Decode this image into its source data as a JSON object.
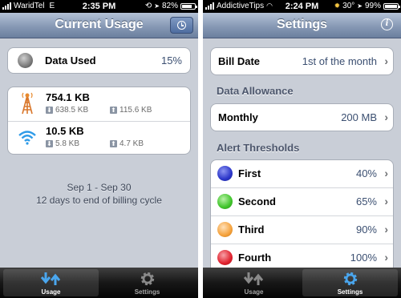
{
  "left_screen": {
    "status": {
      "carrier": "WaridTel",
      "network": "E",
      "time": "2:35 PM",
      "battery": "82%"
    },
    "title": "Current Usage",
    "data_used": {
      "label": "Data Used",
      "value": "15%",
      "indicator_color": "#7a7a7a"
    },
    "cellular": {
      "icon": "cell-tower-icon",
      "total": "754.1 KB",
      "download": "638.5 KB",
      "upload": "115.6 KB"
    },
    "wifi": {
      "icon": "wifi-icon",
      "total": "10.5 KB",
      "download": "5.8 KB",
      "upload": "4.7 KB"
    },
    "period": "Sep 1 - Sep 30",
    "billing_info": "12 days to end of billing cycle",
    "tabs": [
      {
        "label": "Usage",
        "icon": "usage-arrows-icon",
        "active": true
      },
      {
        "label": "Settings",
        "icon": "gear-icon",
        "active": false
      }
    ]
  },
  "right_screen": {
    "status": {
      "carrier": "AddictiveTips",
      "time": "2:24 PM",
      "temperature": "30°",
      "battery": "99%"
    },
    "title": "Settings",
    "bill_date": {
      "label": "Bill Date",
      "value": "1st of the month"
    },
    "data_allowance_header": "Data Allowance",
    "allowance": {
      "label": "Monthly",
      "value": "200 MB"
    },
    "alert_thresholds_header": "Alert Thresholds",
    "thresholds": [
      {
        "label": "First",
        "value": "40%",
        "color": "#2b36c9"
      },
      {
        "label": "Second",
        "value": "65%",
        "color": "#3fc42a"
      },
      {
        "label": "Third",
        "value": "90%",
        "color": "#f5a23c"
      },
      {
        "label": "Fourth",
        "value": "100%",
        "color": "#e0212d"
      }
    ],
    "tabs": [
      {
        "label": "Usage",
        "icon": "usage-arrows-icon",
        "active": false
      },
      {
        "label": "Settings",
        "icon": "gear-icon",
        "active": true
      }
    ]
  }
}
